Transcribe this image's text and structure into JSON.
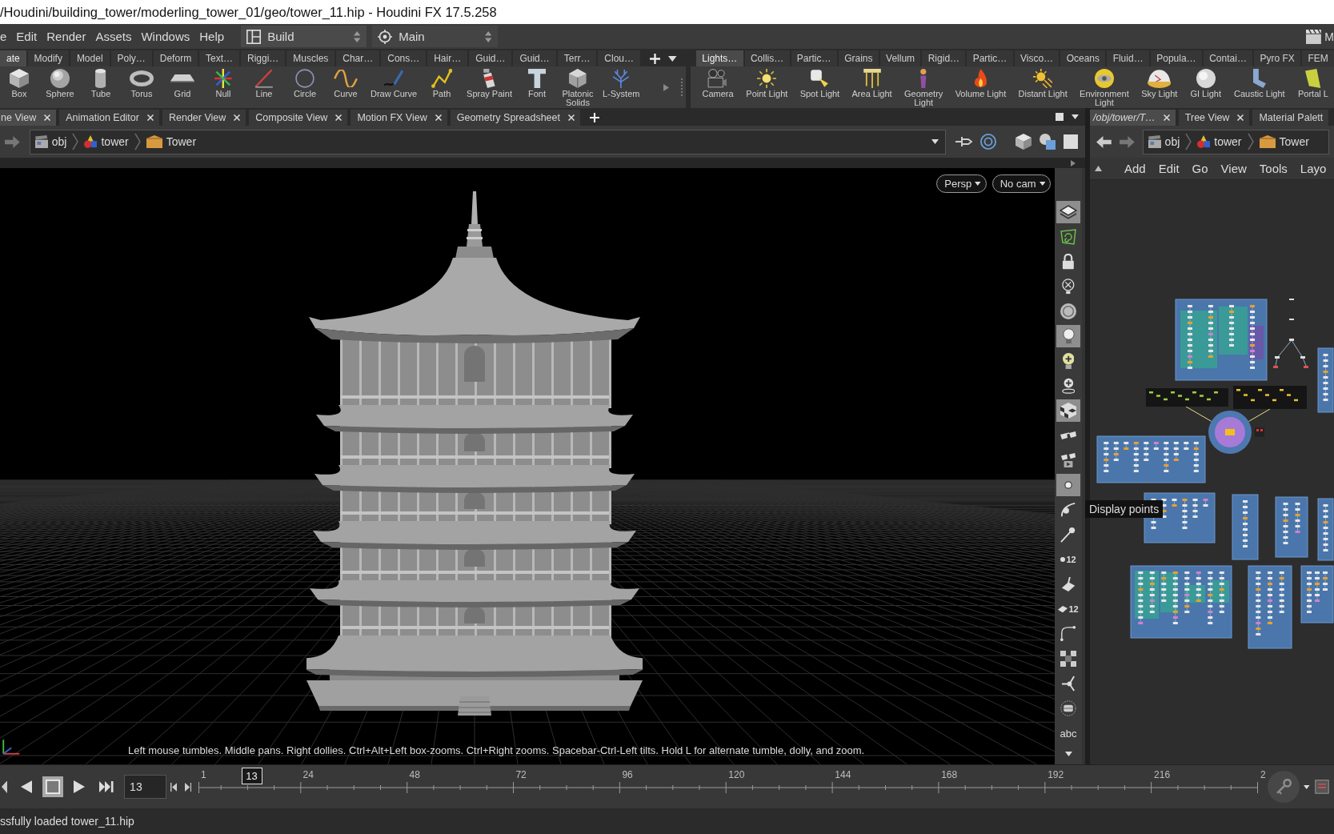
{
  "window": {
    "title": "/Houdini/building_tower/moderling_tower_01/geo/tower_11.hip - Houdini FX 17.5.258"
  },
  "menu_bar": {
    "items": [
      "e",
      "Edit",
      "Render",
      "Assets",
      "Windows",
      "Help"
    ],
    "desktops": [
      {
        "kind": "layout",
        "label": "Build"
      },
      {
        "kind": "target",
        "label": "Main"
      }
    ],
    "corner_label": "M"
  },
  "shelf_left": {
    "tabs": [
      {
        "label": "ate",
        "selected": true
      },
      {
        "label": "Modify",
        "selected": false
      },
      {
        "label": "Model",
        "selected": false
      },
      {
        "label": "Poly…",
        "selected": false
      },
      {
        "label": "Deform",
        "selected": false
      },
      {
        "label": "Text…",
        "selected": false
      },
      {
        "label": "Riggi…",
        "selected": false
      },
      {
        "label": "Muscles",
        "selected": false
      },
      {
        "label": "Char…",
        "selected": false
      },
      {
        "label": "Cons…",
        "selected": false
      },
      {
        "label": "Hair…",
        "selected": false
      },
      {
        "label": "Guid…",
        "selected": false
      },
      {
        "label": "Guid…",
        "selected": false
      },
      {
        "label": "Terr…",
        "selected": false
      },
      {
        "label": "Clou…",
        "selected": false
      }
    ],
    "tools": [
      {
        "kind": "box",
        "label": "Box"
      },
      {
        "kind": "sphere",
        "label": "Sphere"
      },
      {
        "kind": "tube",
        "label": "Tube"
      },
      {
        "kind": "torus",
        "label": "Torus"
      },
      {
        "kind": "grid",
        "label": "Grid"
      },
      {
        "kind": "null",
        "label": "Null"
      },
      {
        "kind": "line",
        "label": "Line"
      },
      {
        "kind": "circle",
        "label": "Circle"
      },
      {
        "kind": "curve",
        "label": "Curve"
      },
      {
        "kind": "draw_curve",
        "label": "Draw Curve"
      },
      {
        "kind": "path",
        "label": "Path"
      },
      {
        "kind": "spray_paint",
        "label": "Spray Paint"
      },
      {
        "kind": "font",
        "label": "Font"
      },
      {
        "kind": "platonic",
        "label": "Platonic\nSolids"
      },
      {
        "kind": "lsystem",
        "label": "L-System"
      }
    ]
  },
  "shelf_right": {
    "tabs": [
      {
        "label": "Lights…",
        "selected": true
      },
      {
        "label": "Collis…",
        "selected": false
      },
      {
        "label": "Partic…",
        "selected": false
      },
      {
        "label": "Grains",
        "selected": false
      },
      {
        "label": "Vellum",
        "selected": false
      },
      {
        "label": "Rigid…",
        "selected": false
      },
      {
        "label": "Partic…",
        "selected": false
      },
      {
        "label": "Visco…",
        "selected": false
      },
      {
        "label": "Oceans",
        "selected": false
      },
      {
        "label": "Fluid…",
        "selected": false
      },
      {
        "label": "Popula…",
        "selected": false
      },
      {
        "label": "Contai…",
        "selected": false
      },
      {
        "label": "Pyro FX",
        "selected": false
      },
      {
        "label": "FEM",
        "selected": false
      }
    ],
    "tools": [
      {
        "kind": "camera",
        "label": "Camera"
      },
      {
        "kind": "point_light",
        "label": "Point Light"
      },
      {
        "kind": "spot_light",
        "label": "Spot Light"
      },
      {
        "kind": "area_light",
        "label": "Area Light"
      },
      {
        "kind": "geometry_light",
        "label": "Geometry\nLight"
      },
      {
        "kind": "volume_light",
        "label": "Volume Light"
      },
      {
        "kind": "distant_light",
        "label": "Distant Light"
      },
      {
        "kind": "environment_light",
        "label": "Environment\nLight"
      },
      {
        "kind": "sky_light",
        "label": "Sky Light"
      },
      {
        "kind": "gi_light",
        "label": "GI Light"
      },
      {
        "kind": "caustic_light",
        "label": "Caustic Light"
      },
      {
        "kind": "portal_light",
        "label": "Portal L"
      }
    ]
  },
  "scene_pane": {
    "tabs": [
      {
        "label": "ne View",
        "selected": true,
        "closable": true
      },
      {
        "label": "Animation Editor",
        "selected": false,
        "closable": true
      },
      {
        "label": "Render View",
        "selected": false,
        "closable": true
      },
      {
        "label": "Composite View",
        "selected": false,
        "closable": true
      },
      {
        "label": "Motion FX View",
        "selected": false,
        "closable": true
      },
      {
        "label": "Geometry Spreadsheet",
        "selected": false,
        "closable": true
      }
    ],
    "path": [
      {
        "kind": "objects",
        "label": "obj"
      },
      {
        "kind": "object",
        "label": "tower"
      },
      {
        "kind": "geometry",
        "label": "Tower"
      }
    ],
    "viewport": {
      "menus": [
        "Persp",
        "No cam"
      ],
      "hint": "Left mouse tumbles. Middle pans. Right dollies. Ctrl+Alt+Left box-zooms. Ctrl+Right zooms. Spacebar-Ctrl-Left tilts. Hold L for alternate tumble, dolly, and zoom."
    },
    "display_tools": [
      {
        "kind": "layers",
        "on": true
      },
      {
        "kind": "snap",
        "on": false
      },
      {
        "kind": "lock",
        "on": false
      },
      {
        "kind": "xray",
        "on": false
      },
      {
        "kind": "ghost",
        "on": false
      },
      {
        "kind": "light",
        "on": true
      },
      {
        "kind": "light_add",
        "on": false
      },
      {
        "kind": "light_pin",
        "on": false
      },
      {
        "kind": "checker",
        "on": true
      },
      {
        "kind": "glasses",
        "on": false
      },
      {
        "kind": "glasses_camera",
        "on": false
      },
      {
        "kind": "points",
        "on": true
      },
      {
        "kind": "point_curve",
        "on": false
      },
      {
        "kind": "needle",
        "on": false
      },
      {
        "kind": "point_numbers",
        "label": "12",
        "on": false
      },
      {
        "kind": "face",
        "on": false
      },
      {
        "kind": "face_numbers",
        "label": "12",
        "on": false
      },
      {
        "kind": "corner",
        "on": false
      },
      {
        "kind": "squares",
        "on": false
      },
      {
        "kind": "normals",
        "on": false
      },
      {
        "kind": "disc",
        "on": false
      },
      {
        "kind": "text",
        "label": "abc",
        "on": false
      }
    ]
  },
  "network_pane": {
    "tabs": [
      {
        "kind": "path",
        "label": "/obj/tower/T…",
        "selected": true,
        "closable": true
      },
      {
        "kind": "pane",
        "label": "Tree View",
        "selected": false,
        "closable": true
      },
      {
        "kind": "pane",
        "label": "Material Palett",
        "selected": false,
        "closable": false
      }
    ],
    "path": [
      {
        "kind": "objects",
        "label": "obj"
      },
      {
        "kind": "object",
        "label": "tower"
      },
      {
        "kind": "geometry",
        "label": "Tower"
      }
    ],
    "menu": [
      "Add",
      "Edit",
      "Go",
      "View",
      "Tools",
      "Layo"
    ]
  },
  "tooltip": {
    "text": "Display points"
  },
  "timeline": {
    "frame": "13",
    "playhead": {
      "label": "13",
      "level": 0.0502
    },
    "ruler_labels": [
      "1",
      "24",
      "48",
      "72",
      "96",
      "120",
      "144",
      "168",
      "192",
      "216",
      "2"
    ]
  },
  "status_bar": {
    "message": "ssfully loaded tower_11.hip"
  }
}
